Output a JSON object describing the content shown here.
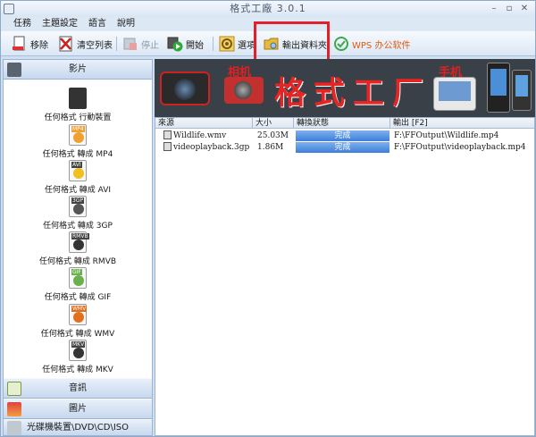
{
  "window": {
    "title": "格式工廠 3.0.1"
  },
  "menu": [
    "任務",
    "主題設定",
    "語言",
    "說明"
  ],
  "toolbar": {
    "remove": "移除",
    "clear_list": "清空列表",
    "stop": "停止",
    "start": "開始",
    "options": "選項",
    "output_folder": "輸出資料夾",
    "wps": "WPS 办公软件"
  },
  "sidebar": {
    "video_header": "影片",
    "audio_header": "音訊",
    "picture_header": "圖片",
    "rom_header": "光碟機裝置\\DVD\\CD\\ISO",
    "items": [
      {
        "label": "任何格式 行動裝置",
        "tag": "",
        "color": "#333333"
      },
      {
        "label": "任何格式 轉成 MP4",
        "tag": "MP4",
        "color": "#f0a030"
      },
      {
        "label": "任何格式 轉成 AVI",
        "tag": "AVI",
        "color": "#f0c020"
      },
      {
        "label": "任何格式 轉成 3GP",
        "tag": "3GP",
        "color": "#555555"
      },
      {
        "label": "任何格式 轉成 RMVB",
        "tag": "RMVB",
        "color": "#333333"
      },
      {
        "label": "任何格式 轉成 GIF",
        "tag": "GIF",
        "color": "#6ab04c"
      },
      {
        "label": "任何格式 轉成 WMV",
        "tag": "WMV",
        "color": "#e07020"
      },
      {
        "label": "任何格式 轉成 MKV",
        "tag": "MKV",
        "color": "#333333"
      }
    ]
  },
  "banner": {
    "camera_label": "相机",
    "title": "格式工厂",
    "phone_label": "手机"
  },
  "table": {
    "headers": [
      "來源",
      "大小",
      "轉換狀態",
      "輸出 [F2]"
    ],
    "rows": [
      {
        "source": "Wildlife.wmv",
        "size": "25.03M",
        "status": "完成",
        "output": "F:\\FFOutput\\Wildlife.mp4"
      },
      {
        "source": "videoplayback.3gp",
        "size": "1.86M",
        "status": "完成",
        "output": "F:\\FFOutput\\videoplayback.mp4"
      }
    ]
  },
  "colors": {
    "accent": "#3e7fd7",
    "highlight": "#e0202a",
    "banner_text": "#e52424"
  }
}
